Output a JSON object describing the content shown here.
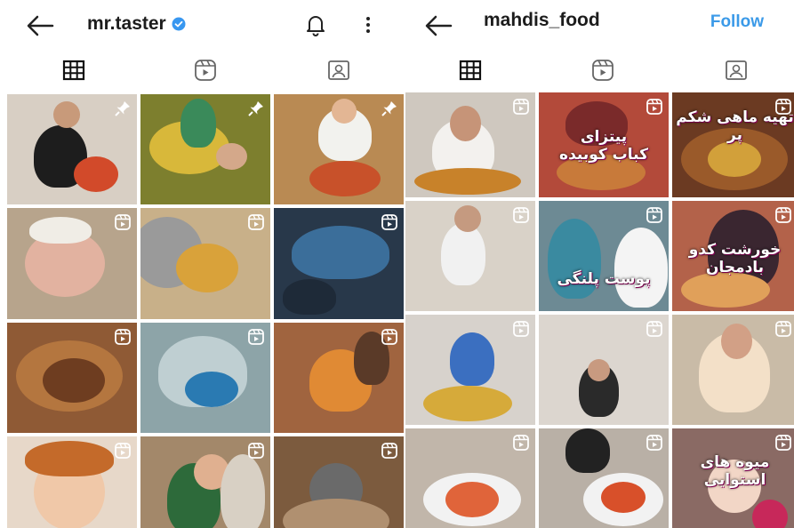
{
  "left_profile": {
    "username": "mr.taster",
    "icons": {
      "back": "arrow-left-icon",
      "verified": "verified-badge-icon",
      "bell": "bell-icon",
      "more": "more-vertical-icon"
    },
    "tabs": [
      "grid-icon",
      "reels-icon",
      "tagged-icon"
    ],
    "posts": [
      {
        "overlay": "pin-icon",
        "bg": "#d8cfc4"
      },
      {
        "overlay": "pin-icon",
        "bg": "#7d7f2e"
      },
      {
        "overlay": "pin-icon",
        "bg": "#b98a53"
      },
      {
        "overlay": "reel-icon",
        "bg": "#b7a48c"
      },
      {
        "overlay": "reel-icon",
        "bg": "#c8b089"
      },
      {
        "overlay": "reel-icon",
        "bg": "#28384a"
      },
      {
        "overlay": "reel-icon",
        "bg": "#8f5a35"
      },
      {
        "overlay": "reel-icon",
        "bg": "#8da4a8"
      },
      {
        "overlay": "reel-icon",
        "bg": "#a0643f"
      },
      {
        "overlay": "reel-icon",
        "bg": "#e7d8c9"
      },
      {
        "overlay": "reel-icon",
        "bg": "#a3886a"
      },
      {
        "overlay": "reel-icon",
        "bg": "#7c5b3e"
      }
    ]
  },
  "right_profile": {
    "username": "mahdis_food",
    "follow_label": "Follow",
    "icons": {
      "back": "arrow-left-icon"
    },
    "tabs": [
      "grid-icon",
      "reels-icon",
      "tagged-icon"
    ],
    "posts": [
      {
        "overlay": "reel-icon",
        "bg": "#cfc8bf",
        "caption": ""
      },
      {
        "overlay": "reel-icon",
        "bg": "#b34a3a",
        "caption": "پیتزای\nکباب کوبیده"
      },
      {
        "overlay": "reel-icon",
        "bg": "#6b3a22",
        "caption": "تهیه ماهی شکم پر"
      },
      {
        "overlay": "reel-icon",
        "bg": "#d9d2c8",
        "caption": ""
      },
      {
        "overlay": "reel-icon",
        "bg": "#6d8a94",
        "caption": "پوست پلنگی"
      },
      {
        "overlay": "reel-icon",
        "bg": "#b3624a",
        "caption": "خورشت کدو بادمجان"
      },
      {
        "overlay": "reel-icon",
        "bg": "#d7d2cc",
        "caption": ""
      },
      {
        "overlay": "reel-icon",
        "bg": "#dcd6cf",
        "caption": ""
      },
      {
        "overlay": "reel-icon",
        "bg": "#c9bba7",
        "caption": ""
      },
      {
        "overlay": "reel-icon",
        "bg": "#c1b6aa",
        "caption": ""
      },
      {
        "overlay": "reel-icon",
        "bg": "#b9b0a6",
        "caption": ""
      },
      {
        "overlay": "reel-icon",
        "bg": "#8a6a64",
        "caption": "میوه های استوایی"
      }
    ]
  },
  "colors": {
    "follow": "#3b9ae8",
    "verified": "#3897f0",
    "text": "#1c1c1c"
  }
}
